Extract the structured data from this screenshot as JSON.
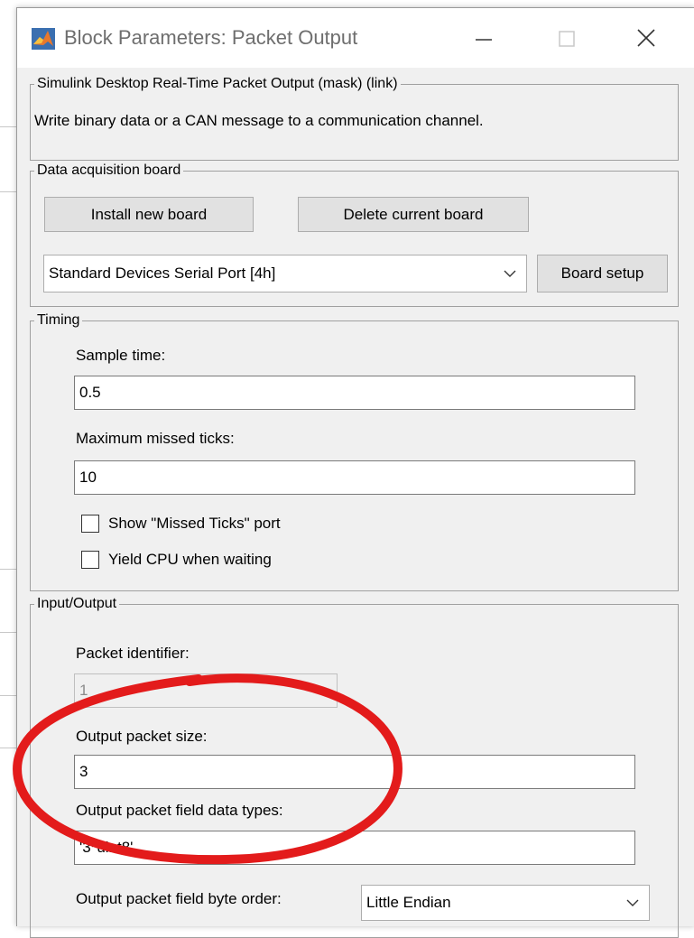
{
  "window": {
    "title": "Block Parameters: Packet Output"
  },
  "description_group": {
    "label": "Simulink Desktop Real-Time Packet Output (mask) (link)",
    "text": "Write binary data or a CAN message to a communication channel."
  },
  "board_group": {
    "label": "Data acquisition board",
    "install_button": "Install new board",
    "delete_button": "Delete current board",
    "board_select": "Standard Devices Serial Port [4h]",
    "setup_button": "Board setup"
  },
  "timing_group": {
    "label": "Timing",
    "sample_time_label": "Sample time:",
    "sample_time_value": "0.5",
    "max_missed_label": "Maximum missed ticks:",
    "max_missed_value": "10",
    "show_missed_label": "Show \"Missed Ticks\" port",
    "yield_cpu_label": "Yield CPU when waiting"
  },
  "io_group": {
    "label": "Input/Output",
    "packet_id_label": "Packet identifier:",
    "packet_id_value": "1",
    "packet_size_label": "Output packet size:",
    "packet_size_value": "3",
    "field_types_label": "Output packet field data types:",
    "field_types_value": "'3*uint8'",
    "byte_order_label": "Output packet field byte order:",
    "byte_order_value": "Little Endian"
  },
  "colors": {
    "annotation": "#e31b1b",
    "dialog_bg": "#f0f0f0"
  }
}
